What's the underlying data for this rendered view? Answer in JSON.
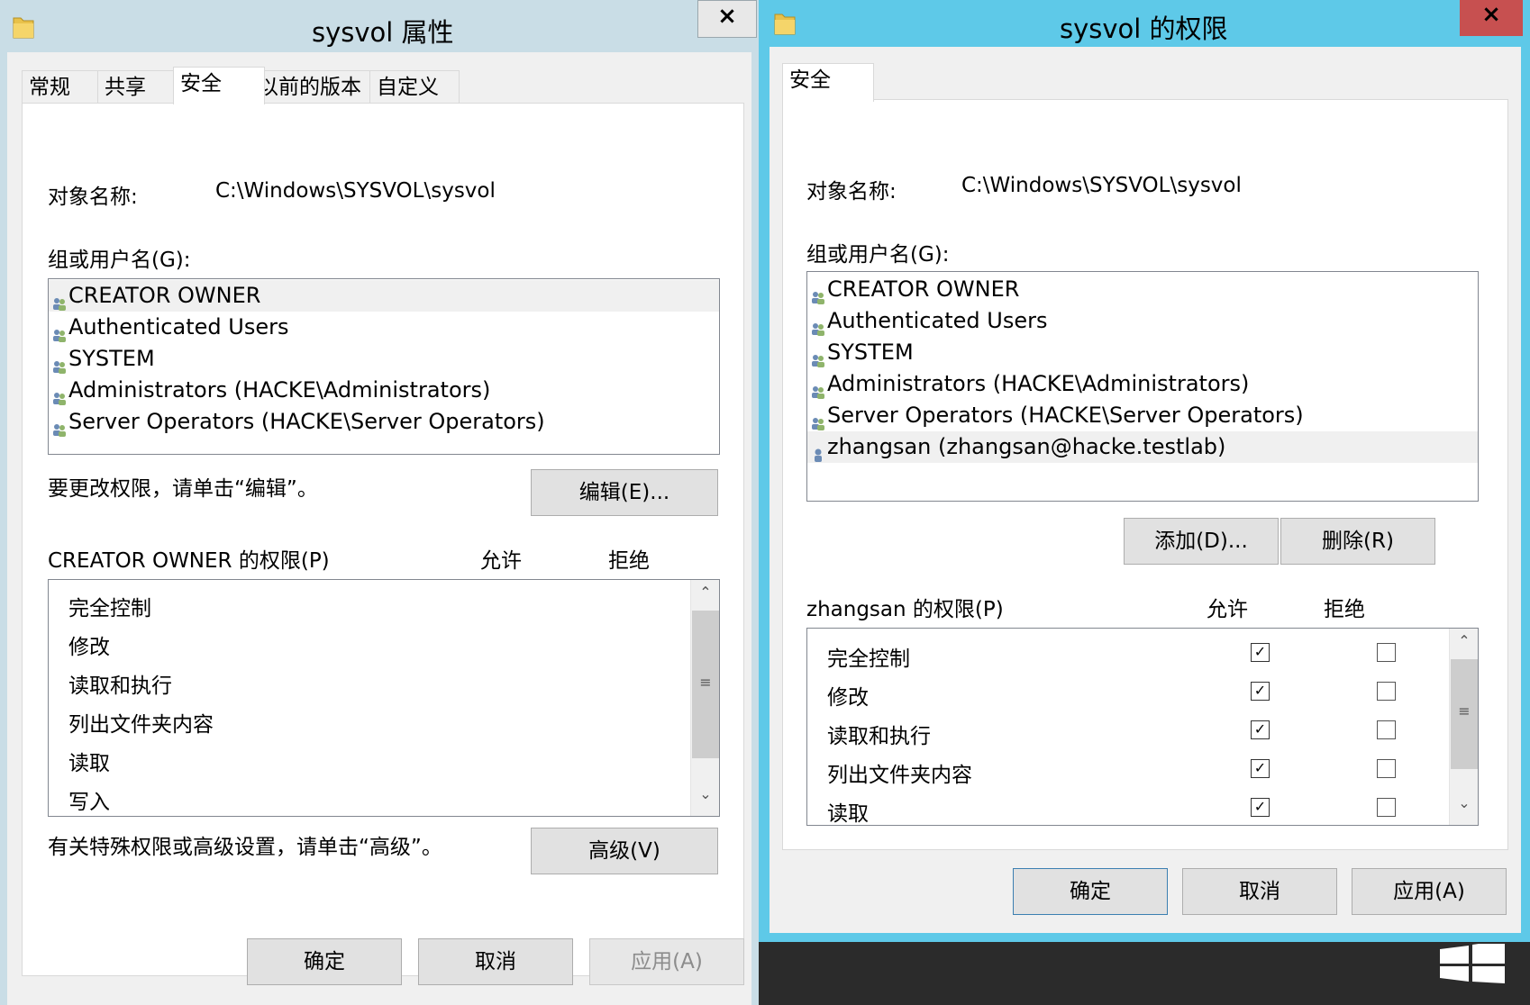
{
  "left_window": {
    "title": "sysvol 属性",
    "close_glyph": "×",
    "tabs": [
      {
        "label": "常规"
      },
      {
        "label": "共享"
      },
      {
        "label": "安全"
      },
      {
        "label": "以前的版本"
      },
      {
        "label": "自定义"
      }
    ],
    "object_name_label": "对象名称:",
    "object_name_value": "C:\\Windows\\SYSVOL\\sysvol",
    "group_label": "组或用户名(G):",
    "users": [
      {
        "name": "CREATOR OWNER"
      },
      {
        "name": "Authenticated Users"
      },
      {
        "name": "SYSTEM"
      },
      {
        "name": "Administrators (HACKE\\Administrators)"
      },
      {
        "name": "Server Operators (HACKE\\Server Operators)"
      }
    ],
    "edit_hint": "要更改权限，请单击“编辑”。",
    "edit_button": "编辑(E)...",
    "perm_header": "CREATOR OWNER 的权限(P)",
    "allow_header": "允许",
    "deny_header": "拒绝",
    "permissions": [
      {
        "name": "完全控制"
      },
      {
        "name": "修改"
      },
      {
        "name": "读取和执行"
      },
      {
        "name": "列出文件夹内容"
      },
      {
        "name": "读取"
      },
      {
        "name": "写入"
      }
    ],
    "advanced_hint": "有关特殊权限或高级设置，请单击“高级”。",
    "advanced_button": "高级(V)",
    "ok_button": "确定",
    "cancel_button": "取消",
    "apply_button": "应用(A)"
  },
  "right_window": {
    "title": "sysvol 的权限",
    "close_glyph": "×",
    "tab": "安全",
    "object_name_label": "对象名称:",
    "object_name_value": "C:\\Windows\\SYSVOL\\sysvol",
    "group_label": "组或用户名(G):",
    "users": [
      {
        "name": "CREATOR OWNER",
        "icon": "group-icon"
      },
      {
        "name": "Authenticated Users",
        "icon": "group-icon"
      },
      {
        "name": "SYSTEM",
        "icon": "group-icon"
      },
      {
        "name": "Administrators (HACKE\\Administrators)",
        "icon": "group-icon"
      },
      {
        "name": "Server Operators (HACKE\\Server Operators)",
        "icon": "group-icon"
      },
      {
        "name": "zhangsan (zhangsan@hacke.testlab)",
        "icon": "user-icon"
      }
    ],
    "add_button": "添加(D)...",
    "remove_button": "删除(R)",
    "perm_header": "zhangsan 的权限(P)",
    "allow_header": "允许",
    "deny_header": "拒绝",
    "permissions": [
      {
        "name": "完全控制",
        "allow": true,
        "deny": false
      },
      {
        "name": "修改",
        "allow": true,
        "deny": false
      },
      {
        "name": "读取和执行",
        "allow": true,
        "deny": false
      },
      {
        "name": "列出文件夹内容",
        "allow": true,
        "deny": false
      },
      {
        "name": "读取",
        "allow": true,
        "deny": false
      }
    ],
    "ok_button": "确定",
    "cancel_button": "取消",
    "apply_button": "应用(A)"
  },
  "colors": {
    "left_title_bar": "#c9dde6",
    "right_title_bar": "#5ec9e8",
    "right_close_button": "#c75050",
    "dialog_bg": "#f0f0f0",
    "taskbar": "#2b2b2b"
  },
  "icons": {
    "scroll_up": "⌃",
    "scroll_down": "⌄",
    "scroll_grip": "≡",
    "check": "✓"
  }
}
